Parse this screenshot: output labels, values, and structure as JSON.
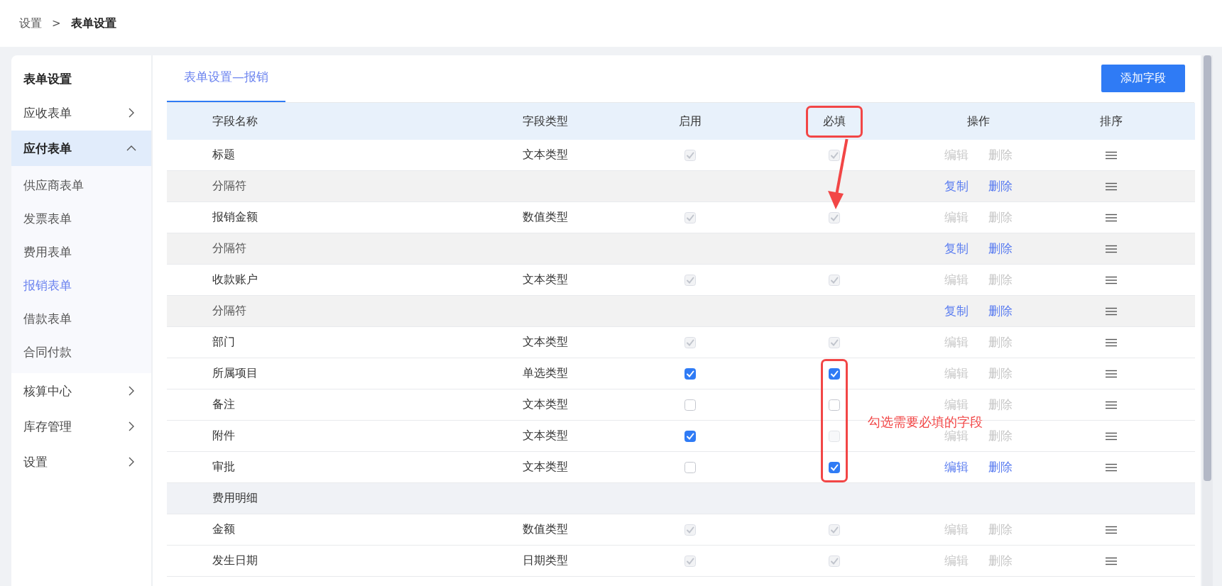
{
  "breadcrumb": [
    {
      "label": "设置",
      "current": false
    },
    {
      "label": "表单设置",
      "current": true
    }
  ],
  "breadcrumb_separator": ">",
  "sidebar": {
    "title": "表单设置",
    "items": [
      {
        "label": "应收表单",
        "expanded": false,
        "selected": false
      },
      {
        "label": "应付表单",
        "expanded": true,
        "selected": false,
        "children": [
          {
            "label": "供应商表单",
            "selected": false
          },
          {
            "label": "发票表单",
            "selected": false
          },
          {
            "label": "费用表单",
            "selected": false
          },
          {
            "label": "报销表单",
            "selected": true
          },
          {
            "label": "借款表单",
            "selected": false
          },
          {
            "label": "合同付款",
            "selected": false
          }
        ]
      },
      {
        "label": "核算中心",
        "expanded": false,
        "selected": false
      },
      {
        "label": "库存管理",
        "expanded": false,
        "selected": false
      },
      {
        "label": "设置",
        "expanded": false,
        "selected": false
      }
    ]
  },
  "tabs": [
    {
      "label": "表单设置—报销",
      "selected": true
    }
  ],
  "add_button": "添加字段",
  "table": {
    "columns": [
      {
        "label": "字段名称"
      },
      {
        "label": "字段类型"
      },
      {
        "label": "启用"
      },
      {
        "label": "必填"
      },
      {
        "label": "操作"
      },
      {
        "label": "排序"
      }
    ],
    "rows": [
      {
        "kind": "field",
        "name": "标题",
        "type": "文本类型",
        "enabled": {
          "checked": true,
          "disabled": true
        },
        "required": {
          "checked": true,
          "disabled": true
        },
        "actions": [
          {
            "label": "编辑",
            "disabled": true
          },
          {
            "label": "删除",
            "disabled": true
          }
        ]
      },
      {
        "kind": "separator",
        "name": "分隔符",
        "actions": [
          {
            "label": "复制",
            "disabled": false
          },
          {
            "label": "删除",
            "disabled": false
          }
        ]
      },
      {
        "kind": "field",
        "name": "报销金额",
        "type": "数值类型",
        "enabled": {
          "checked": true,
          "disabled": true
        },
        "required": {
          "checked": true,
          "disabled": true
        },
        "actions": [
          {
            "label": "编辑",
            "disabled": true
          },
          {
            "label": "删除",
            "disabled": true
          }
        ]
      },
      {
        "kind": "separator",
        "name": "分隔符",
        "actions": [
          {
            "label": "复制",
            "disabled": false
          },
          {
            "label": "删除",
            "disabled": false
          }
        ]
      },
      {
        "kind": "field",
        "name": "收款账户",
        "type": "文本类型",
        "enabled": {
          "checked": true,
          "disabled": true
        },
        "required": {
          "checked": true,
          "disabled": true
        },
        "actions": [
          {
            "label": "编辑",
            "disabled": true
          },
          {
            "label": "删除",
            "disabled": true
          }
        ]
      },
      {
        "kind": "separator",
        "name": "分隔符",
        "actions": [
          {
            "label": "复制",
            "disabled": false
          },
          {
            "label": "删除",
            "disabled": false
          }
        ]
      },
      {
        "kind": "field",
        "name": "部门",
        "type": "文本类型",
        "enabled": {
          "checked": true,
          "disabled": true
        },
        "required": {
          "checked": true,
          "disabled": true
        },
        "actions": [
          {
            "label": "编辑",
            "disabled": true
          },
          {
            "label": "删除",
            "disabled": true
          }
        ]
      },
      {
        "kind": "field",
        "name": "所属项目",
        "type": "单选类型",
        "enabled": {
          "checked": true,
          "disabled": false
        },
        "required": {
          "checked": true,
          "disabled": false
        },
        "actions": [
          {
            "label": "编辑",
            "disabled": true
          },
          {
            "label": "删除",
            "disabled": true
          }
        ]
      },
      {
        "kind": "field",
        "name": "备注",
        "type": "文本类型",
        "enabled": {
          "checked": false,
          "disabled": false
        },
        "required": {
          "checked": false,
          "disabled": false
        },
        "actions": [
          {
            "label": "编辑",
            "disabled": true
          },
          {
            "label": "删除",
            "disabled": true
          }
        ]
      },
      {
        "kind": "field",
        "name": "附件",
        "type": "文本类型",
        "enabled": {
          "checked": true,
          "disabled": false
        },
        "required": {
          "checked": false,
          "disabled": true
        },
        "actions": [
          {
            "label": "编辑",
            "disabled": true
          },
          {
            "label": "删除",
            "disabled": true
          }
        ]
      },
      {
        "kind": "field",
        "name": "审批",
        "type": "文本类型",
        "enabled": {
          "checked": false,
          "disabled": false
        },
        "required": {
          "checked": true,
          "disabled": false
        },
        "actions": [
          {
            "label": "编辑",
            "disabled": false
          },
          {
            "label": "删除",
            "disabled": false
          }
        ]
      },
      {
        "kind": "group",
        "name": "费用明细"
      },
      {
        "kind": "field",
        "name": "金额",
        "type": "数值类型",
        "enabled": {
          "checked": true,
          "disabled": true
        },
        "required": {
          "checked": true,
          "disabled": true
        },
        "actions": [
          {
            "label": "编辑",
            "disabled": true
          },
          {
            "label": "删除",
            "disabled": true
          }
        ]
      },
      {
        "kind": "field",
        "name": "发生日期",
        "type": "日期类型",
        "enabled": {
          "checked": true,
          "disabled": true
        },
        "required": {
          "checked": true,
          "disabled": true
        },
        "actions": [
          {
            "label": "编辑",
            "disabled": true
          },
          {
            "label": "删除",
            "disabled": true
          }
        ]
      }
    ]
  },
  "annotations": [
    {
      "kind": "header_box"
    },
    {
      "kind": "arrow"
    },
    {
      "kind": "rows_box"
    },
    {
      "kind": "note",
      "text": "勾选需要必填的字段"
    }
  ]
}
